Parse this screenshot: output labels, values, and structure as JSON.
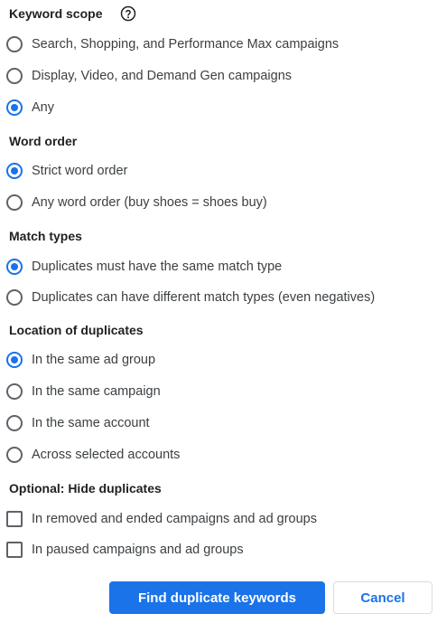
{
  "keyword_scope": {
    "heading": "Keyword scope",
    "help_icon": "help-circle-icon",
    "options": [
      {
        "label": "Search, Shopping, and Performance Max campaigns",
        "selected": false
      },
      {
        "label": "Display, Video, and Demand Gen campaigns",
        "selected": false
      },
      {
        "label": "Any",
        "selected": true
      }
    ]
  },
  "word_order": {
    "heading": "Word order",
    "options": [
      {
        "label": "Strict word order",
        "selected": true
      },
      {
        "label": "Any word order (buy shoes = shoes buy)",
        "selected": false
      }
    ]
  },
  "match_types": {
    "heading": "Match types",
    "options": [
      {
        "label": "Duplicates must have the same match type",
        "selected": true
      },
      {
        "label": "Duplicates can have different match types (even negatives)",
        "selected": false
      }
    ]
  },
  "location": {
    "heading": "Location of duplicates",
    "options": [
      {
        "label": "In the same ad group",
        "selected": true
      },
      {
        "label": "In the same campaign",
        "selected": false
      },
      {
        "label": "In the same account",
        "selected": false
      },
      {
        "label": "Across selected accounts",
        "selected": false
      }
    ]
  },
  "hide_duplicates": {
    "heading": "Optional: Hide duplicates",
    "options": [
      {
        "label": "In removed and ended campaigns and ad groups",
        "checked": false
      },
      {
        "label": "In paused campaigns and ad groups",
        "checked": false
      }
    ]
  },
  "actions": {
    "find_label": "Find duplicate keywords",
    "cancel_label": "Cancel"
  },
  "colors": {
    "accent": "#1a73e8",
    "control_border": "#5f6368",
    "text": "#3c4043"
  }
}
